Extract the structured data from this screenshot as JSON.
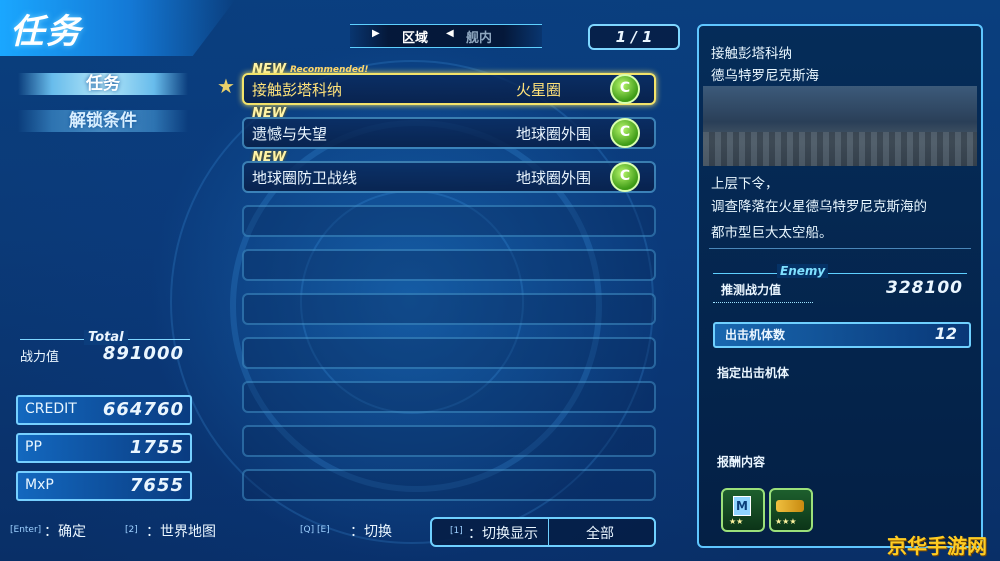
{
  "header": {
    "title": "任务"
  },
  "sidebar": {
    "tab_mission": "任务",
    "tab_unlock": "解锁条件"
  },
  "tabs": {
    "left": "区域",
    "right": "舰内"
  },
  "pager": "1 / 1",
  "missions": [
    {
      "tag": "NEW",
      "recommended": "Recommended!",
      "name": "接触彭塔科纳",
      "area": "火星圈",
      "rank": "C",
      "selected": true
    },
    {
      "tag": "NEW",
      "name": "遗憾与失望",
      "area": "地球圈外围",
      "rank": "C"
    },
    {
      "tag": "NEW",
      "name": "地球圈防卫战线",
      "area": "地球圈外围",
      "rank": "C"
    }
  ],
  "stats": {
    "total_label": "Total",
    "power_label": "战力值",
    "power_value": "891000",
    "credit_label": "CREDIT",
    "credit_value": "664760",
    "pp_label": "PP",
    "pp_value": "1755",
    "mxp_label": "MxP",
    "mxp_value": "7655"
  },
  "detail": {
    "title_line1": "接触彭塔科纳",
    "title_line2": "德乌特罗尼克斯海",
    "desc_line1": "上层下令，",
    "desc_line2": "调查降落在火星德乌特罗尼克斯海的",
    "desc_line3": "都市型巨大太空船。",
    "enemy_label": "Enemy",
    "est_power_label": "推测战力值",
    "est_power_value": "328100",
    "sortie_label": "出击机体数",
    "sortie_value": "12",
    "designated_label": "指定出击机体",
    "reward_label": "报酬内容",
    "reward1_stars": "★★",
    "reward2_stars": "★★★"
  },
  "controls": {
    "enter_key": "[Enter]",
    "enter_label": "：确定",
    "map_key": "[2]",
    "map_label": "：世界地图",
    "switch_keys": "[Q]  [E]",
    "switch_label": "：切换",
    "display_key": "[1]",
    "display_label": "：切换显示",
    "display_value": "全部"
  },
  "watermark": "京华手游网"
}
